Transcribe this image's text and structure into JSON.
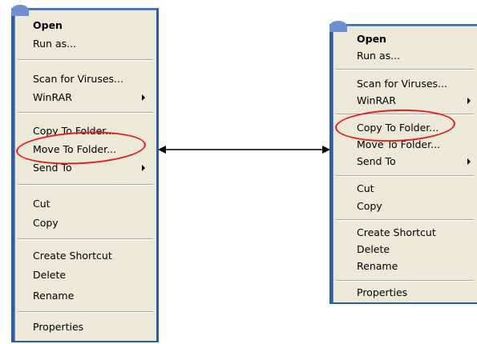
{
  "menu_left": {
    "items": [
      {
        "label": "Open",
        "bold": true
      },
      {
        "label": "Run as..."
      },
      {
        "label": "Scan for Viruses..."
      },
      {
        "label": "WinRAR",
        "submenu": true
      },
      {
        "label": "Copy To Folder..."
      },
      {
        "label": "Move To Folder..."
      },
      {
        "label": "Send To",
        "submenu": true
      },
      {
        "label": "Cut"
      },
      {
        "label": "Copy"
      },
      {
        "label": "Create Shortcut"
      },
      {
        "label": "Delete"
      },
      {
        "label": "Rename"
      },
      {
        "label": "Properties"
      }
    ],
    "highlighted": "Move To Folder..."
  },
  "menu_right": {
    "items": [
      {
        "label": "Open",
        "bold": true
      },
      {
        "label": "Run as..."
      },
      {
        "label": "Scan for Viruses..."
      },
      {
        "label": "WinRAR",
        "submenu": true
      },
      {
        "label": "Copy To Folder..."
      },
      {
        "label": "Move To Folder..."
      },
      {
        "label": "Send To",
        "submenu": true
      },
      {
        "label": "Cut"
      },
      {
        "label": "Copy"
      },
      {
        "label": "Create Shortcut"
      },
      {
        "label": "Delete"
      },
      {
        "label": "Rename"
      },
      {
        "label": "Properties"
      }
    ],
    "highlighted": "Copy To Folder..."
  },
  "colors": {
    "menu_background": "#ece9d8",
    "menu_border": "#2f5e9a",
    "highlight_circle": "#e02020",
    "connector_arrow": "#000000"
  },
  "icons": {
    "connector": "double-headed-arrow-icon",
    "submenu": "chevron-right-icon"
  }
}
